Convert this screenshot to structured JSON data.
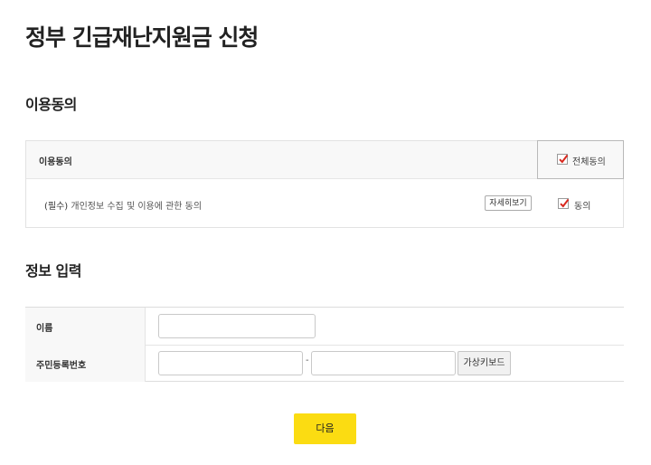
{
  "page": {
    "title": "정부 긴급재난지원금 신청"
  },
  "agreement": {
    "section_title": "이용동의",
    "header_label": "이용동의",
    "all_agree": {
      "label": "전체동의",
      "checked": true
    },
    "items": [
      {
        "required_tag": "(필수)",
        "text": " 개인정보 수집 및 이용에 관한 동의",
        "detail_button": "자세히보기",
        "agree_label": "동의",
        "checked": true
      }
    ]
  },
  "info": {
    "section_title": "정보 입력",
    "name_label": "이름",
    "name_value": "",
    "rrn_label": "주민등록번호",
    "rrn_front_value": "",
    "rrn_back_value": "",
    "separator": "-",
    "virtual_keyboard_button": "가상키보드"
  },
  "actions": {
    "next_button": "다음"
  },
  "colors": {
    "accent": "#fbdc12",
    "check": "#d9281e"
  },
  "icons": {
    "checkbox": "checkbox-checked-icon"
  }
}
